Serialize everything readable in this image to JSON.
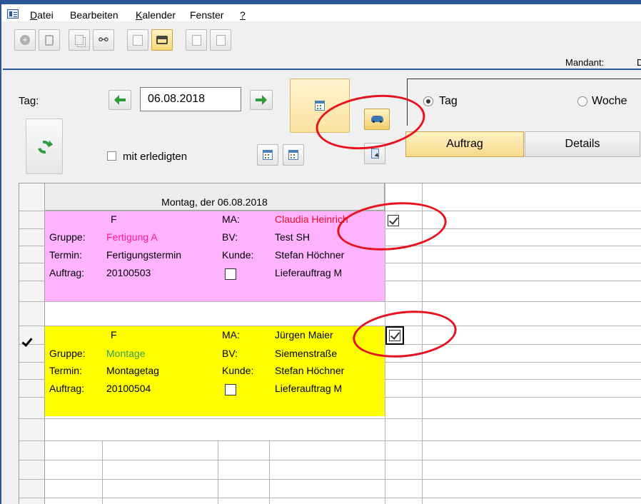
{
  "menu": {
    "items": [
      {
        "label": "Datei",
        "underline": "D",
        "rest": "atei"
      },
      {
        "label": "Bearbeiten",
        "underline": "",
        "rest": "Bearbeiten"
      },
      {
        "label": "Kalender",
        "underline": "K",
        "rest": "alender"
      },
      {
        "label": "Fenster",
        "underline": "",
        "rest": "Fenster"
      },
      {
        "label": "?",
        "underline": "?",
        "rest": ""
      }
    ]
  },
  "toolbar": {
    "buttons": [
      "add-icon",
      "trash-icon",
      "copy-icon",
      "binoculars-icon",
      "form-icon",
      "print-icon",
      "document-icon",
      "document-add-icon"
    ],
    "active_button": "print-icon",
    "mandant_label": "Mandant:",
    "mandant_value": "D"
  },
  "controls": {
    "day_label": "Tag:",
    "date_value": "06.08.2018",
    "show_completed_label": "mit erledigten",
    "show_completed_checked": false
  },
  "view": {
    "radio_day_label": "Tag",
    "radio_week_label": "Woche",
    "selected": "Tag",
    "tabs": [
      {
        "label": "Auftrag",
        "active": true
      },
      {
        "label": "Details",
        "active": false
      }
    ]
  },
  "grid": {
    "day_header": "Montag, der 06.08.2018",
    "cards": [
      {
        "color": "#ffb3ff",
        "type": "F",
        "ma_label": "MA:",
        "ma_value": "Claudia Heinrich",
        "checked": true,
        "gruppe_label": "Gruppe:",
        "gruppe_value": "Fertigung A",
        "bv_label": "BV:",
        "bv_value": "Test SH",
        "termin_label": "Termin:",
        "termin_value": "Fertigungstermin",
        "kunde_label": "Kunde:",
        "kunde_value": "Stefan Höchner",
        "auftrag_label": "Auftrag:",
        "auftrag_value": "20100503",
        "auftrag_checked": false,
        "lieferauftrag_value": "Lieferauftrag M"
      },
      {
        "color": "#ffff00",
        "type": "F",
        "ma_label": "MA:",
        "ma_value": "Jürgen Maier",
        "checked": true,
        "gruppe_label": "Gruppe:",
        "gruppe_value": "Montage",
        "bv_label": "BV:",
        "bv_value": "Siemenstraße",
        "termin_label": "Termin:",
        "termin_value": "Montagetag",
        "kunde_label": "Kunde:",
        "kunde_value": "Stefan Höchner",
        "auftrag_label": "Auftrag:",
        "auftrag_value": "20100504",
        "auftrag_checked": false,
        "lieferauftrag_value": "Lieferauftrag M"
      }
    ]
  },
  "colors": {
    "accent_blue": "#2b5797",
    "annotation_red": "#e8121e",
    "active_button": "#f8d874"
  }
}
